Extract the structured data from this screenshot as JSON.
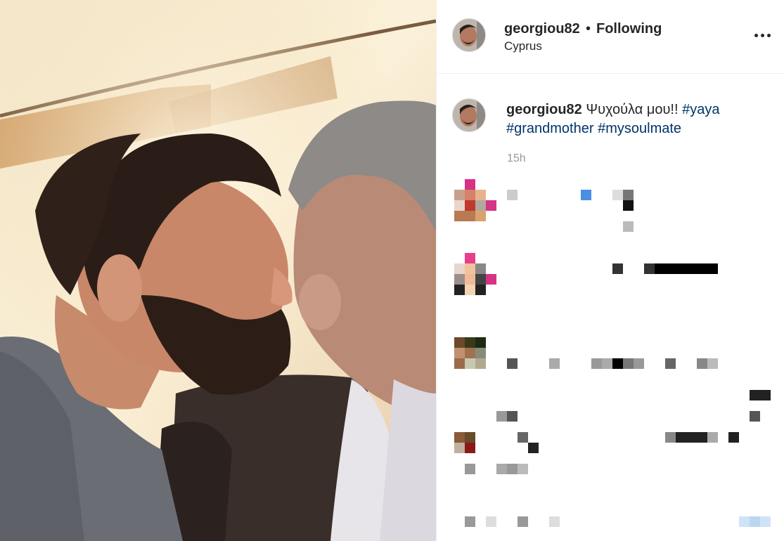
{
  "post": {
    "username": "georgiou82",
    "separator": "•",
    "follow_status": "Following",
    "location": "Cyprus",
    "more_icon": "more-options-icon",
    "caption": {
      "username": "georgiou82",
      "text": "Ψυχούλα μου!!",
      "hashtags": [
        "#yaya",
        "#grandmother",
        "#mysoulmate"
      ]
    },
    "timestamp": "15h"
  },
  "photo": {
    "description_icon": "photo"
  },
  "colors": {
    "hashtag": "#003569",
    "timestamp": "#999999",
    "divider": "#efefef"
  }
}
